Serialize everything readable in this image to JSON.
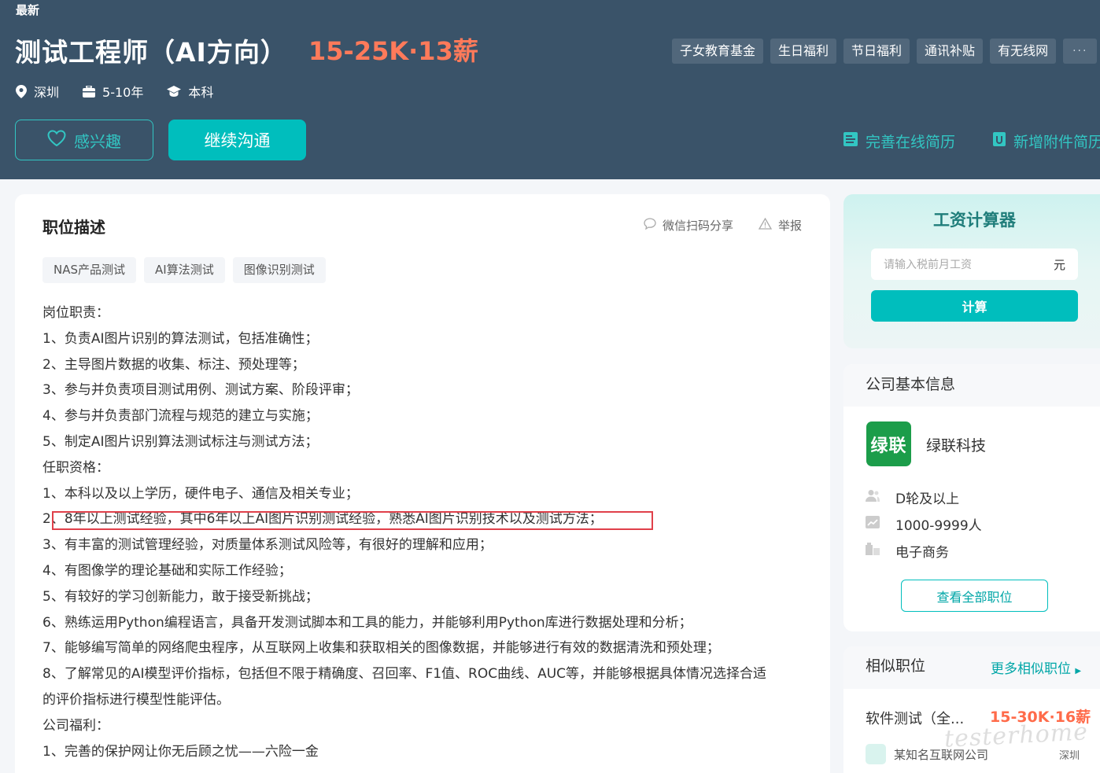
{
  "header": {
    "latest_tag": "最新",
    "title": "测试工程师（AI方向）",
    "salary": "15-25K·13薪",
    "benefits": [
      "子女教育基金",
      "生日福利",
      "节日福利",
      "通讯补贴",
      "有无线网"
    ],
    "benefits_more": "···",
    "meta": {
      "city": "深圳",
      "experience": "5-10年",
      "degree": "本科"
    },
    "interest_label": "感兴趣",
    "chat_label": "继续沟通",
    "resume_online_label": "完善在线简历",
    "resume_attach_label": "新增附件简历"
  },
  "description": {
    "title": "职位描述",
    "share_label": "微信扫码分享",
    "report_label": "举报",
    "tags": [
      "NAS产品测试",
      "AI算法测试",
      "图像识别测试"
    ],
    "lines": [
      "岗位职责：",
      "1、负责AI图片识别的算法测试，包括准确性；",
      "2、主导图片数据的收集、标注、预处理等；",
      "3、参与并负责项目测试用例、测试方案、阶段评审；",
      "4、参与并负责部门流程与规范的建立与实施；",
      "5、制定AI图片识别算法测试标注与测试方法；",
      "任职资格：",
      "1、本科以及以上学历，硬件电子、通信及相关专业；",
      "2、8年以上测试经验，其中6年以上AI图片识别测试经验，熟悉AI图片识别技术以及测试方法；",
      "3、有丰富的测试管理经验，对质量体系测试风险等，有很好的理解和应用；",
      "4、有图像学的理论基础和实际工作经验；",
      "5、有较好的学习创新能力，敢于接受新挑战；",
      "6、熟练运用Python编程语言，具备开发测试脚本和工具的能力，并能够利用Python库进行数据处理和分析；",
      "7、能够编写简单的网络爬虫程序，从互联网上收集和获取相关的图像数据，并能够进行有效的数据清洗和预处理；",
      "8、了解常见的AI模型评价指标，包括但不限于精确度、召回率、F1值、ROC曲线、AUC等，并能够根据具体情况选择合适",
      "的评价指标进行模型性能评估。",
      "公司福利：",
      "1、完善的保护网让你无后顾之忧——六险一金"
    ]
  },
  "calculator": {
    "title": "工资计算器",
    "placeholder": "请输入税前月工资",
    "unit": "元",
    "button_label": "计算"
  },
  "company": {
    "header": "公司基本信息",
    "logo_text": "绿联",
    "name": "绿联科技",
    "funding": "D轮及以上",
    "size": "1000-9999人",
    "industry": "电子商务",
    "all_jobs_label": "查看全部职位"
  },
  "similar": {
    "header": "相似职位",
    "more_label": "更多相似职位",
    "job_title": "软件测试（全...",
    "job_salary": "15-30K·16薪",
    "job_company": "某知名互联网公司",
    "job_city": "深圳"
  },
  "watermark": "testerhome",
  "colors": {
    "header_bg": "#3a5369",
    "accent": "#00bebd",
    "salary": "#ff7a5a",
    "highlight": "#e0404a",
    "logo_green": "#1c9d4a"
  }
}
